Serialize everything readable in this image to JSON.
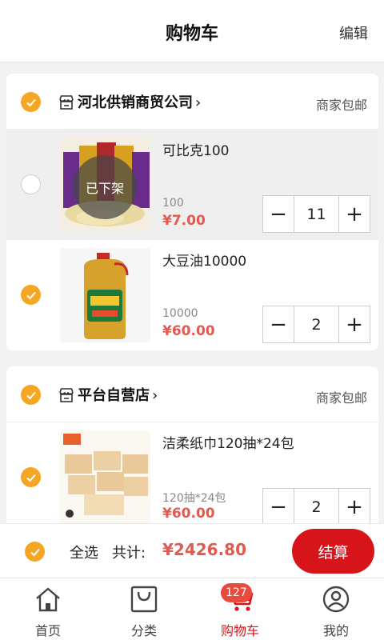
{
  "header": {
    "title": "购物车",
    "edit_label": "编辑"
  },
  "stores": [
    {
      "name": "河北供销商贸公司",
      "shipping": "商家包邮",
      "checked": true,
      "items": [
        {
          "name": "可比克100",
          "spec": "100",
          "price": "¥7.00",
          "qty": "11",
          "status": "已下架",
          "checked": false
        },
        {
          "name": "大豆油10000",
          "spec": "10000",
          "price": "¥60.00",
          "qty": "2",
          "checked": true
        }
      ]
    },
    {
      "name": "平台自营店",
      "shipping": "商家包邮",
      "checked": true,
      "items": [
        {
          "name": "洁柔纸巾120抽*24包",
          "spec": "120抽*24包",
          "price": "¥60.00",
          "qty": "2",
          "checked": true
        }
      ]
    }
  ],
  "footer": {
    "select_all": "全选",
    "total_label": "共计:",
    "total_value": "¥2426.80",
    "checkout_label": "结算",
    "checked": true
  },
  "tabs": [
    {
      "label": "首页",
      "icon": "home-icon"
    },
    {
      "label": "分类",
      "icon": "bag-icon"
    },
    {
      "label": "购物车",
      "icon": "cart-icon",
      "active": true,
      "badge": "127"
    },
    {
      "label": "我的",
      "icon": "user-icon"
    }
  ],
  "colors": {
    "accent": "#f5a623",
    "price": "#e05a50",
    "checkout": "#d8141b",
    "badge": "#e94a3b"
  }
}
